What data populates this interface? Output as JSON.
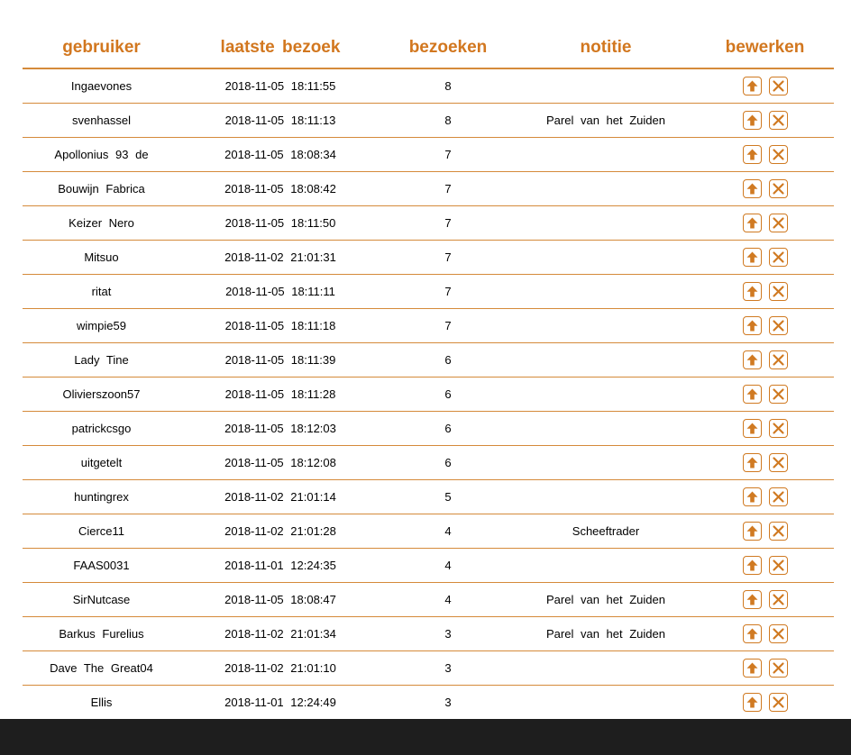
{
  "colors": {
    "accent": "#d2771f",
    "rule": "#d58a3a",
    "footer_bar": "#1e1e1e"
  },
  "table": {
    "headers": {
      "user": "gebruiker",
      "last_visit": "laatste bezoek",
      "visits": "bezoeken",
      "note": "notitie",
      "edit": "bewerken"
    },
    "icons": {
      "promote": "arrow-up-icon",
      "remove": "close-x-icon"
    },
    "rows": [
      {
        "user": "Ingaevones",
        "last_visit": "2018-11-05 18:11:55",
        "visits": "8",
        "note": ""
      },
      {
        "user": "svenhassel",
        "last_visit": "2018-11-05 18:11:13",
        "visits": "8",
        "note": "Parel van het Zuiden"
      },
      {
        "user": "Apollonius 93 de",
        "last_visit": "2018-11-05 18:08:34",
        "visits": "7",
        "note": ""
      },
      {
        "user": "Bouwijn Fabrica",
        "last_visit": "2018-11-05 18:08:42",
        "visits": "7",
        "note": ""
      },
      {
        "user": "Keizer Nero",
        "last_visit": "2018-11-05 18:11:50",
        "visits": "7",
        "note": ""
      },
      {
        "user": "Mitsuo",
        "last_visit": "2018-11-02 21:01:31",
        "visits": "7",
        "note": ""
      },
      {
        "user": "ritat",
        "last_visit": "2018-11-05 18:11:11",
        "visits": "7",
        "note": ""
      },
      {
        "user": "wimpie59",
        "last_visit": "2018-11-05 18:11:18",
        "visits": "7",
        "note": ""
      },
      {
        "user": "Lady Tine",
        "last_visit": "2018-11-05 18:11:39",
        "visits": "6",
        "note": ""
      },
      {
        "user": "Olivierszoon57",
        "last_visit": "2018-11-05 18:11:28",
        "visits": "6",
        "note": ""
      },
      {
        "user": "patrickcsgo",
        "last_visit": "2018-11-05 18:12:03",
        "visits": "6",
        "note": ""
      },
      {
        "user": "uitgetelt",
        "last_visit": "2018-11-05 18:12:08",
        "visits": "6",
        "note": ""
      },
      {
        "user": "huntingrex",
        "last_visit": "2018-11-02 21:01:14",
        "visits": "5",
        "note": ""
      },
      {
        "user": "Cierce11",
        "last_visit": "2018-11-02 21:01:28",
        "visits": "4",
        "note": "Scheeftrader"
      },
      {
        "user": "FAAS0031",
        "last_visit": "2018-11-01 12:24:35",
        "visits": "4",
        "note": ""
      },
      {
        "user": "SirNutcase",
        "last_visit": "2018-11-05 18:08:47",
        "visits": "4",
        "note": "Parel van het Zuiden"
      },
      {
        "user": "Barkus Furelius",
        "last_visit": "2018-11-02 21:01:34",
        "visits": "3",
        "note": "Parel van het Zuiden"
      },
      {
        "user": "Dave The Great04",
        "last_visit": "2018-11-02 21:01:10",
        "visits": "3",
        "note": ""
      },
      {
        "user": "Ellis",
        "last_visit": "2018-11-01 12:24:49",
        "visits": "3",
        "note": ""
      }
    ]
  }
}
